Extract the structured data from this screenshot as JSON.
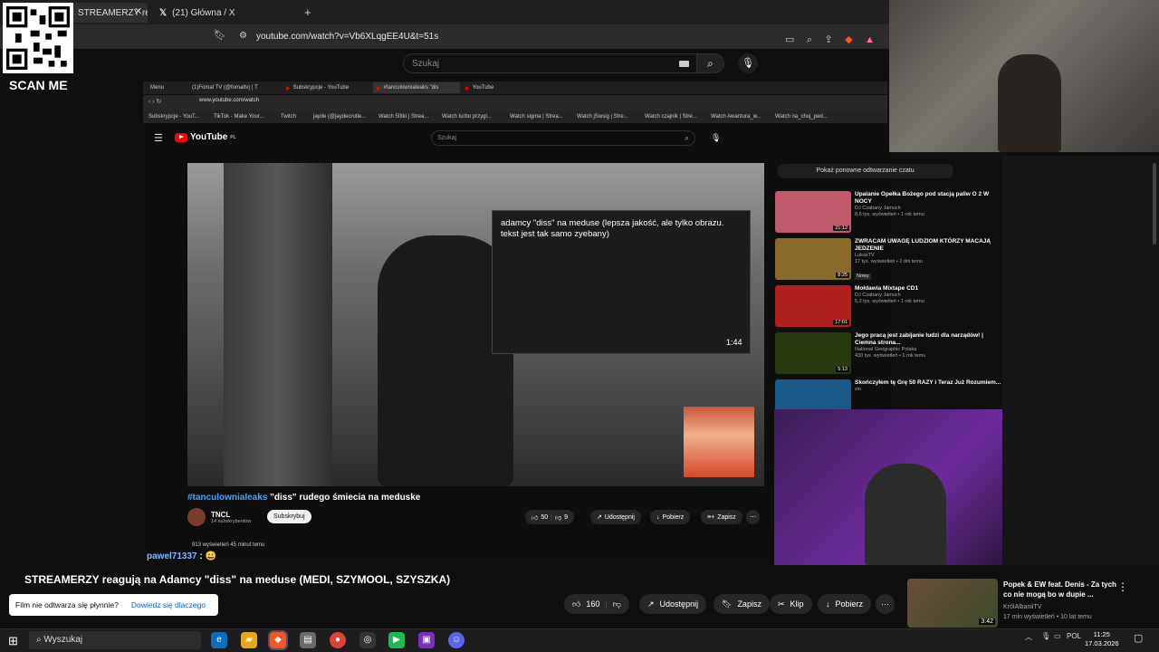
{
  "browser": {
    "tabs": [
      {
        "label": "STREAMERZY reagują na A"
      },
      {
        "label": "(21) Główna / X"
      }
    ],
    "new_tab": "+",
    "url": "youtube.com/watch?v=Vb6XLqgEE4U&t=51s"
  },
  "overlay": {
    "qr_caption": "SCAN ME"
  },
  "yt_header": {
    "search_placeholder": "Szukaj"
  },
  "inner_browser": {
    "tabs": [
      {
        "label": "Menu"
      },
      {
        "label": "(1)Fomal TV (@fomaltv) | T"
      },
      {
        "label": "Subskrypcje - YouTube"
      },
      {
        "label": "#tanculowniaIeaks \"dis"
      },
      {
        "label": "YouTube"
      }
    ],
    "url": "www.youtube.com/watch",
    "bookmarks": [
      "Subskrypcje - YouT...",
      "TikTok - Make Your...",
      "Twitch",
      "jayde (@jaydecrutle...",
      "Watch 50tki | Strea...",
      "Watch turbo przygl...",
      "Watch sigma | Strea...",
      "Watch jSwsig | Stre...",
      "Watch czajnik | Stre...",
      "Watch Awantura_w...",
      "Watch na_chuj_ped..."
    ],
    "logo": "YouTube",
    "logo_suffix": "PL",
    "search_placeholder": "Szukaj",
    "video": {
      "pip_caption": "adamcy \"diss\" na meduse (lepsza jakość, ale tylko obrazu. tekst jest tak samo zyebany)",
      "pip_duration": "1:44",
      "title_tag": "#tanculowniaIeaks",
      "title_rest": " \"diss\" rudego śmiecia na meduske",
      "channel": "TNCL",
      "subscribers": "14 subskrybentów",
      "subscribe": "Subskrybuj",
      "likes": "50",
      "dislikes": "9",
      "share": "Udostępnij",
      "download": "Pobierz",
      "save": "Zapisz",
      "views": "913 wyświetleń  45 minut temu"
    },
    "replay_hint": "Pokaż ponowne odtwarzanie czatu",
    "recommendations": [
      {
        "title": "Upalanie Opełka Bożego pod stacją paliw O 2 W NOCY",
        "channel": "DJ Czabany Jamuch",
        "meta": "8,6 tys. wyświetleń • 1 rok temu",
        "duration": "21:12",
        "color": "#c05a6d"
      },
      {
        "title": "ZWRACAM UWAGĘ LUDZIOM KTÓRZY MACAJĄ JEDZENIE",
        "channel": "LukasTV",
        "meta": "17 tys. wyświetleń • 2 dni temu",
        "badge": "Nowy",
        "duration": "8:25",
        "color": "#8a6a2a"
      },
      {
        "title": "Mołdawia Mixtape CD1",
        "channel": "DJ Czabany Jamuch",
        "meta": "5,2 tys. wyświetleń • 1 rok temu",
        "duration": "17:01",
        "color": "#b02020"
      },
      {
        "title": "Jego pracą jest zabijanie ludzi dla narządów! | Ciemna strona...",
        "channel": "National Geographic Polska",
        "meta": "430 tys. wyświetleń • 1 rok temu",
        "duration": "5:13",
        "color": "#2a3a10"
      },
      {
        "title": "Skończyłem tę Grę 50 RAZY i Teraz Już Rozumiem...",
        "channel": "zio",
        "meta": "",
        "duration": "",
        "color": "#1a5a8a"
      }
    ]
  },
  "chat": {
    "user": "pawel71337",
    "message": ": 😀"
  },
  "main": {
    "title": "STREAMERZY reagują na Adamcy \"diss\" na meduse (MEDI, SZYMOOL, SZYSZKA)",
    "toast_text": "Film nie odtwarza się płynnie?",
    "toast_link": "Dowiedz się dlaczego",
    "likes": "160",
    "share": "Udostępnij",
    "save": "Zapisz",
    "clip": "Klip",
    "download": "Pobierz",
    "more": "⋯"
  },
  "side_rec": {
    "title": "Popek & EW feat. Denis - Za tych co nie mogą bo w dupie ...",
    "channel": "KrólAlbaniiTV",
    "meta": "17 mln wyświetleń • 10 lat temu",
    "duration": "3:42"
  },
  "taskbar": {
    "search": "Wyszukaj",
    "lang": "POL",
    "time": "11:25",
    "date": "17.03.2026"
  }
}
